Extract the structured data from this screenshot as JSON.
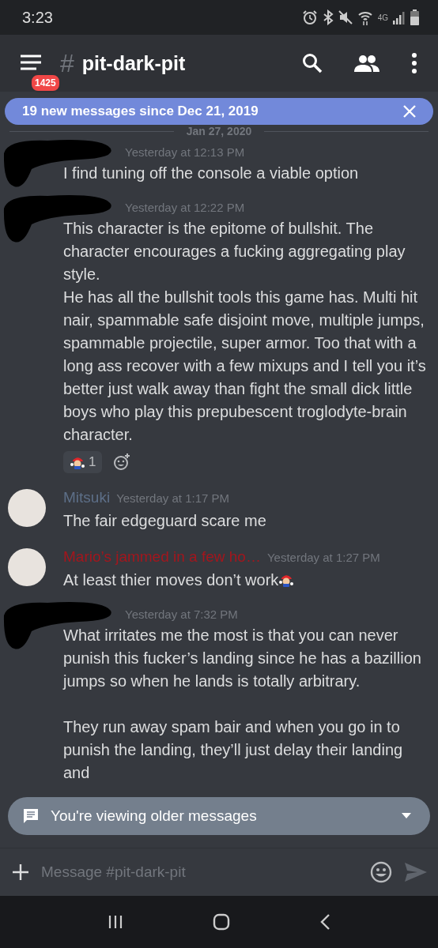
{
  "status_bar": {
    "time": "3:23",
    "network": "4G"
  },
  "header": {
    "unread_badge": "1425",
    "hash": "#",
    "channel": "pit-dark-pit"
  },
  "new_messages_banner": {
    "text": "19 new messages since Dec 21, 2019"
  },
  "date_divider": "Jan 27, 2020",
  "messages": [
    {
      "redacted": true,
      "time": "Yesterday at 12:13 PM",
      "paragraphs": [
        "I find tuning off the console a viable option"
      ]
    },
    {
      "redacted": true,
      "time": "Yesterday at 12:22 PM",
      "paragraphs": [
        "This character is the epitome of bullshit. The character encourages a fucking aggregating play style.",
        "He has all the bullshit tools this game has. Multi hit nair, spammable safe disjoint move, multiple jumps, spammable projectile, super armor. Too that with a long ass recover with a few mixups and I tell you it’s better just walk away than fight the small dick little boys who play this prepubescent troglodyte-brain character."
      ],
      "reactions": [
        {
          "count": "1"
        }
      ]
    },
    {
      "redacted": false,
      "author": "Mitsuki",
      "color": "#5d6f88",
      "time": "Yesterday at 1:17 PM",
      "paragraphs": [
        "The fair edgeguard scare me"
      ]
    },
    {
      "redacted": false,
      "author": "Mario’s jammed in a few ho…",
      "color": "#a3161d",
      "time": "Yesterday at 1:27 PM",
      "paragraphs": [
        "At least thier moves don’t work"
      ],
      "trailing_emoji": true
    },
    {
      "redacted": true,
      "time": "Yesterday at 7:32 PM",
      "spaced": true,
      "paragraphs": [
        "What irritates me the most is that you can never punish this fucker’s landing since he has a bazillion jumps so when he lands is totally arbitrary.",
        "They run away spam bair and when you go in to punish the landing, they’ll just delay their landing and"
      ]
    }
  ],
  "older_messages_bar": {
    "text": "You're viewing older messages"
  },
  "composer": {
    "placeholder": "Message #pit-dark-pit"
  }
}
